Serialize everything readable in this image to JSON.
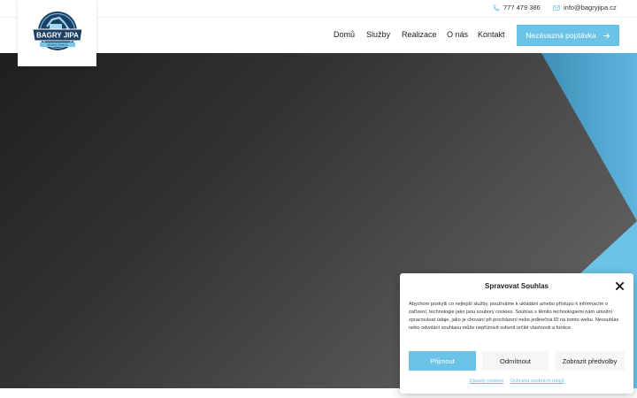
{
  "colors": {
    "accent": "#6cc3e8",
    "hero_dark": "#1f1f1f",
    "navy": "#1d3f63"
  },
  "topbar": {
    "phone": "777 479 386",
    "phone_icon": "phone-icon",
    "email": "info@bagryjipa.cz",
    "email_icon": "mail-icon"
  },
  "logo": {
    "name": "BAGRY JIPA",
    "sub": "ZEMNÍ PRÁCE",
    "est_left": "EST",
    "est_right": "2010"
  },
  "nav": {
    "items": [
      {
        "label": "Domů"
      },
      {
        "label": "Služby"
      },
      {
        "label": "Realizace"
      },
      {
        "label": "O nás"
      },
      {
        "label": "Kontakt"
      }
    ],
    "cta_label": "Nezávazná poptávka",
    "cta_icon": "arrow-right-icon"
  },
  "cookie": {
    "title": "Spravovat Souhlas",
    "close_icon": "close-icon",
    "text": "Abychom poskytli co nejlepší služby, používáme k ukládání a/nebo přístupu k informacím o zařízení, technologie jako jsou soubory cookies. Souhlas s těmito technologiemi nám umožní zpracovávat údaje, jako je chování při procházení nebo jedinečná ID na tomto webu. Nesouhlas nebo odvolání souhlasu může nepříznivě ovlivnit určité vlastnosti a funkce.",
    "accept": "Přijmout",
    "deny": "Odmítnout",
    "prefs": "Zobrazit předvolby",
    "link_cookies": "Zásady cookies",
    "link_privacy": "Ochrana osobních údajů"
  }
}
